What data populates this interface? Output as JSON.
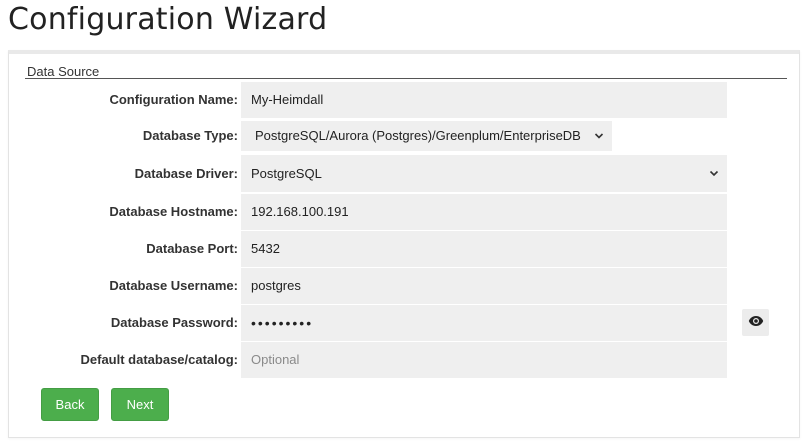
{
  "page": {
    "title": "Configuration Wizard"
  },
  "panel": {
    "legend": "Data Source"
  },
  "form": {
    "configuration_name": {
      "label": "Configuration Name:",
      "value": "My-Heimdall"
    },
    "database_type": {
      "label": "Database Type:",
      "value": "PostgreSQL/Aurora (Postgres)/Greenplum/EnterpriseDB"
    },
    "database_driver": {
      "label": "Database Driver:",
      "value": "PostgreSQL"
    },
    "database_hostname": {
      "label": "Database Hostname:",
      "value": "192.168.100.191"
    },
    "database_port": {
      "label": "Database Port:",
      "value": "5432"
    },
    "database_username": {
      "label": "Database Username:",
      "value": "postgres"
    },
    "database_password": {
      "label": "Database Password:",
      "value": "•••••••••"
    },
    "default_database": {
      "label": "Default database/catalog:",
      "placeholder": "Optional"
    }
  },
  "buttons": {
    "back_label": "Back",
    "next_label": "Next"
  },
  "icons": {
    "select_chevron": "chevron-down-icon",
    "show_password": "eye-icon"
  },
  "colors": {
    "button_green": "#4cae4c",
    "field_background": "#efefef"
  }
}
